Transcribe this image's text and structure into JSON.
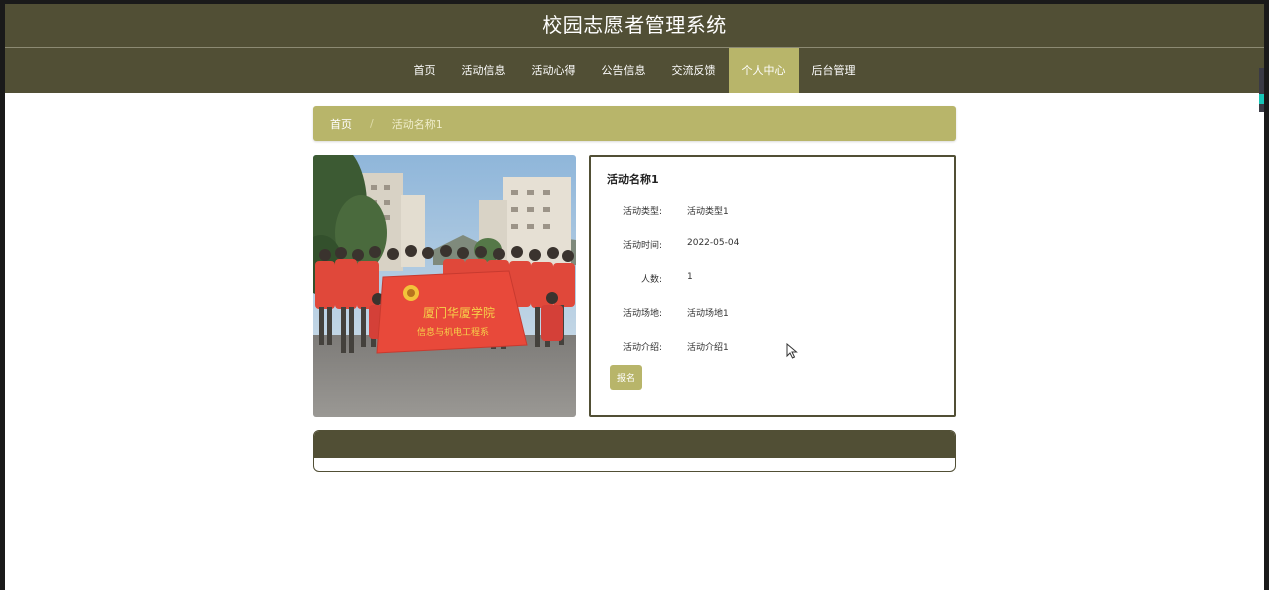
{
  "header": {
    "title": "校园志愿者管理系统"
  },
  "nav": {
    "items": [
      {
        "label": "首页"
      },
      {
        "label": "活动信息"
      },
      {
        "label": "活动心得"
      },
      {
        "label": "公告信息"
      },
      {
        "label": "交流反馈"
      },
      {
        "label": "个人中心"
      },
      {
        "label": "后台管理"
      }
    ],
    "active": "个人中心"
  },
  "breadcrumb": {
    "home": "首页",
    "separator": "/",
    "current": "活动名称1"
  },
  "photo": {
    "banner_line1": "厦门华厦学院",
    "banner_line2": "信息与机电工程系"
  },
  "detail": {
    "title": "活动名称1",
    "fields": [
      {
        "label": "活动类型:",
        "value": "活动类型1"
      },
      {
        "label": "活动时间:",
        "value": "2022-05-04"
      },
      {
        "label": "人数:",
        "value": "1"
      },
      {
        "label": "活动场地:",
        "value": "活动场地1"
      },
      {
        "label": "活动介绍:",
        "value": "活动介绍1"
      }
    ],
    "signup_label": "报名"
  },
  "colors": {
    "primary": "#514f35",
    "accent": "#b8b56a",
    "background": "#ffffff"
  },
  "icons": {
    "cursor": "mouse-pointer-icon",
    "banner_logo": "sunflower-icon"
  }
}
